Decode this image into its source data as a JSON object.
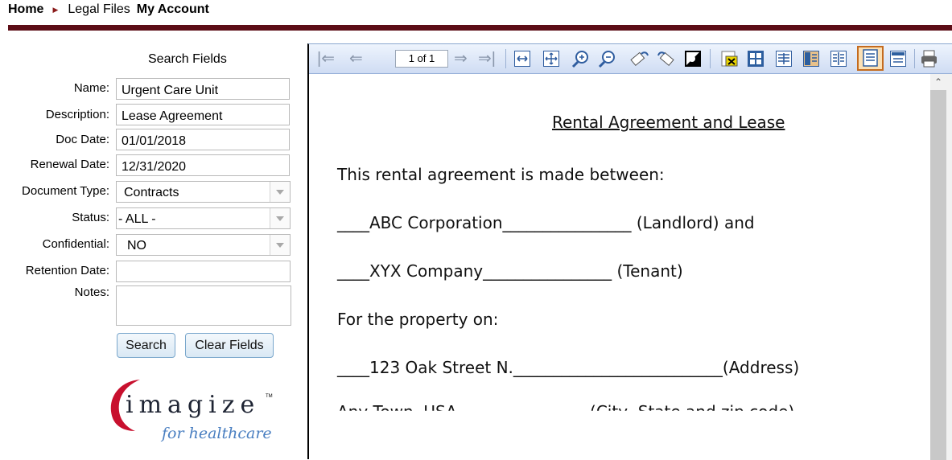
{
  "nav": {
    "home": "Home",
    "legal_files": "Legal Files",
    "my_account": "My Account"
  },
  "search": {
    "title": "Search Fields",
    "fields": {
      "name": {
        "label": "Name:",
        "value": "Urgent Care Unit"
      },
      "description": {
        "label": "Description:",
        "value": "Lease Agreement"
      },
      "doc_date": {
        "label": "Doc Date:",
        "value": "01/01/2018"
      },
      "renewal_date": {
        "label": "Renewal Date:",
        "value": "12/31/2020"
      },
      "document_type": {
        "label": "Document Type:",
        "value": "Contracts"
      },
      "status": {
        "label": "Status:",
        "value": "- ALL -"
      },
      "confidential": {
        "label": "Confidential:",
        "value": "NO"
      },
      "retention_date": {
        "label": "Retention Date:",
        "value": ""
      },
      "notes": {
        "label": "Notes:",
        "value": ""
      }
    },
    "buttons": {
      "search": "Search",
      "clear": "Clear Fields"
    }
  },
  "logo": {
    "word": "imagize",
    "tm": "TM",
    "sub": "for healthcare"
  },
  "viewer": {
    "page_indicator": "1 of 1",
    "icons": [
      "first-page-icon",
      "prev-page-icon",
      "next-page-icon",
      "last-page-icon",
      "fit-width-icon",
      "fit-page-icon",
      "zoom-in-icon",
      "zoom-out-icon",
      "rotate-left-icon",
      "rotate-right-icon",
      "invert-icon",
      "thumbnails-icon",
      "layout-icon",
      "print-icon"
    ],
    "document": {
      "title": "Rental Agreement and Lease",
      "lines": [
        "This rental agreement is made between:",
        "____ABC Corporation________________ (Landlord) and",
        "____XYX Company________________ (Tenant)",
        "For the property on:",
        "____123 Oak Street N.__________________________(Address)",
        "Any Town, USA                          (City, State and zip code)"
      ]
    }
  },
  "colors": {
    "topbar": "#5c0d16",
    "accent_arrow": "#8a1b1b",
    "logo_red": "#c8102e",
    "logo_blue": "#4a7fc1"
  }
}
